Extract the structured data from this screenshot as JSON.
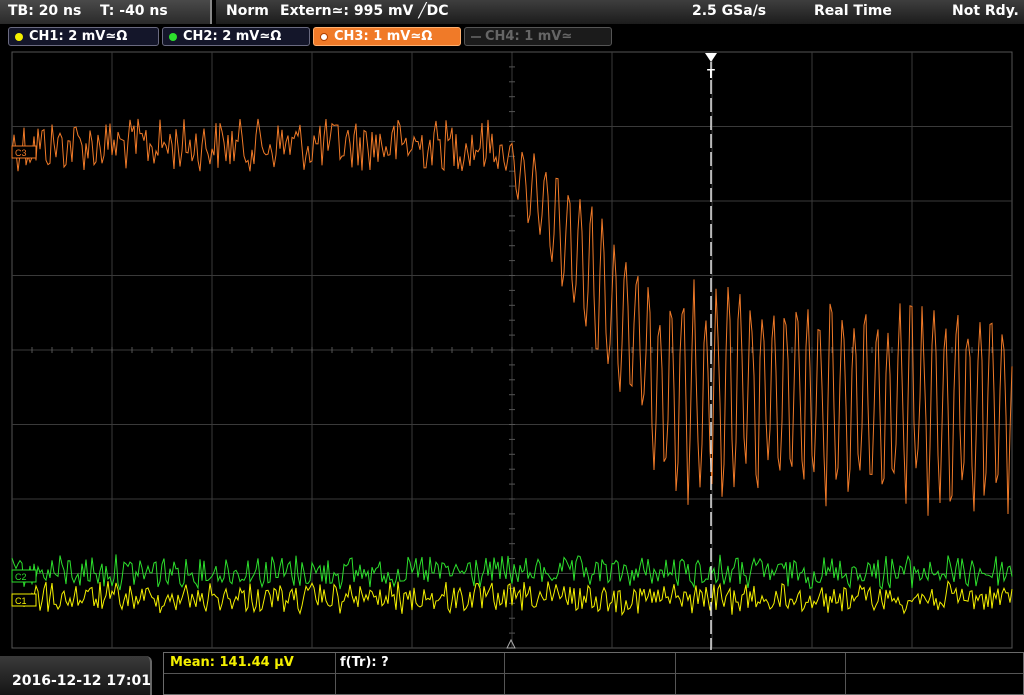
{
  "timebase": {
    "tb_label": "TB: 20 ns",
    "t_label": "T: -40 ns"
  },
  "status": {
    "mode": "Norm",
    "trigger": "Extern≃: 995 mV ╱DC",
    "sample_rate": "2.5 GSa/s",
    "acquisition": "Real Time",
    "state": "Not Rdy."
  },
  "channels": [
    {
      "label": "CH1: 2 mV≃Ω",
      "color": "#f4f000",
      "active": true
    },
    {
      "label": "CH2: 2 mV≃Ω",
      "color": "#2de02d",
      "active": true
    },
    {
      "label": "CH3: 1 mV≃Ω",
      "color": "#f07a28",
      "active": true,
      "selected": true
    },
    {
      "label": "CH4: 1 mV≃",
      "color": "#666666",
      "active": false
    }
  ],
  "markers": {
    "trigger_marker": "T",
    "ch3_marker": "C3",
    "ch2_marker": "C2",
    "ch1_marker": "C1"
  },
  "datetime": "2016-12-12 17:01",
  "measurements": {
    "mean": "Mean: 141.44 µV",
    "f_tr": "f(Tr): ?"
  },
  "colors": {
    "ch1": "#f4f000",
    "ch2": "#2de02d",
    "ch3": "#f07a28",
    "grid": "#444444",
    "trigger_line": "#ffffff"
  }
}
